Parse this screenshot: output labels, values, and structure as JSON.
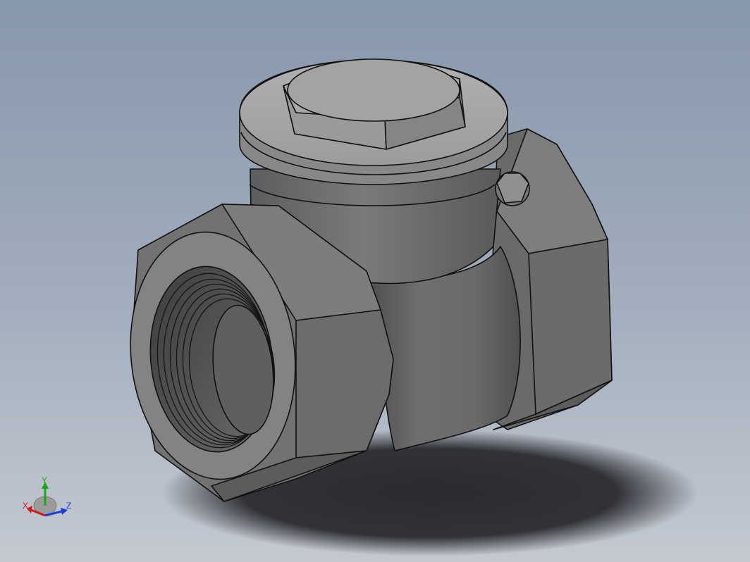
{
  "viewport": {
    "background_top": "#8797ac",
    "background_bottom": "#c4c9d1",
    "model": {
      "name": "swing-check-valve",
      "icon": "check-valve-model-icon",
      "face_colors": {
        "light": "#b9b9b9",
        "mid": "#8a8a8a",
        "dark": "#5c5c5c",
        "edge": "#111111"
      }
    },
    "shadow_color": "#2a2b2f"
  },
  "triad": {
    "x_label": "X",
    "y_label": "Y",
    "z_label": "Z",
    "x_color": "#d01818",
    "y_color": "#1aa81a",
    "z_color": "#1a3fd0"
  }
}
